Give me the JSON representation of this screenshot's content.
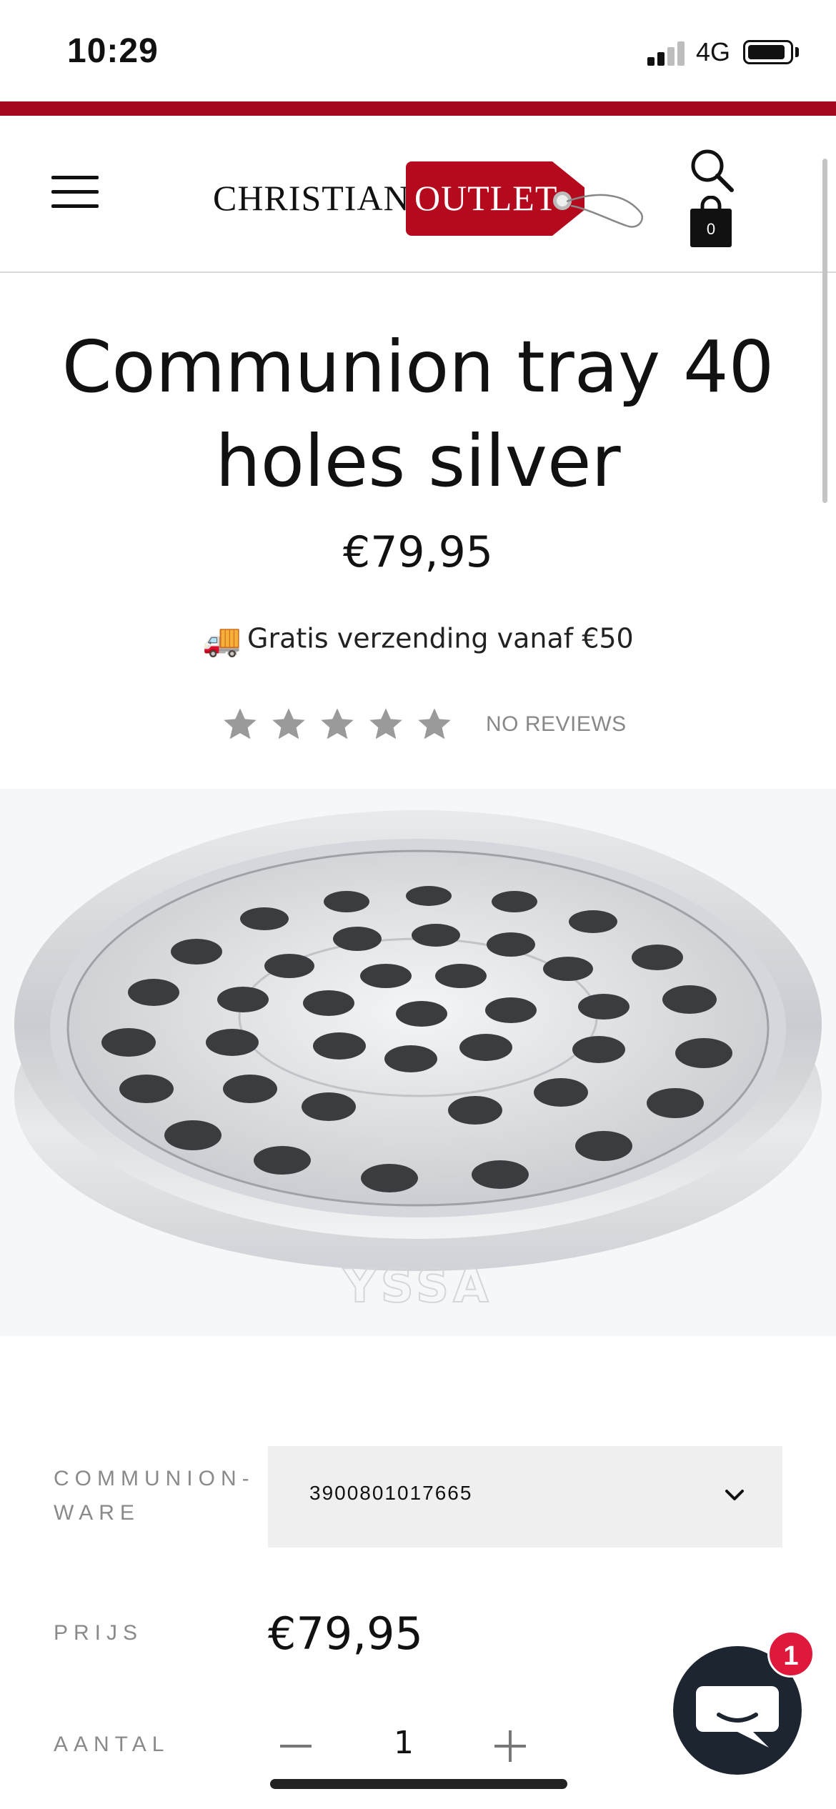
{
  "status_bar": {
    "time": "10:29",
    "network": "4G",
    "signal_bars_active": 2,
    "signal_bars_total": 4,
    "battery_level": 0.8
  },
  "brand": {
    "accent_color": "#a3091e",
    "logo_part_1": "CHRISTIAN",
    "logo_part_2": "OUTLET"
  },
  "header": {
    "cart_count": "0",
    "icons": [
      "menu-icon",
      "search-icon",
      "cart-icon"
    ]
  },
  "product": {
    "title": "Communion tray 40 holes silver",
    "price": "€79,95",
    "shipping_icon": "truck-icon",
    "shipping_text": "Gratis verzending vanaf €50",
    "rating_stars": 0,
    "rating_max": 5,
    "rating_text": "NO REVIEWS",
    "image_watermark": "YSSA"
  },
  "options": {
    "variant_label_line1": "COMMUNION-",
    "variant_label_line2": "WARE",
    "variant_value": "3900801017665",
    "price_label": "PRIJS",
    "price_value": "€79,95",
    "quantity_label": "AANTAL",
    "quantity_value": "1"
  },
  "chat": {
    "badge_count": "1",
    "icon": "chat-bubble-icon"
  }
}
